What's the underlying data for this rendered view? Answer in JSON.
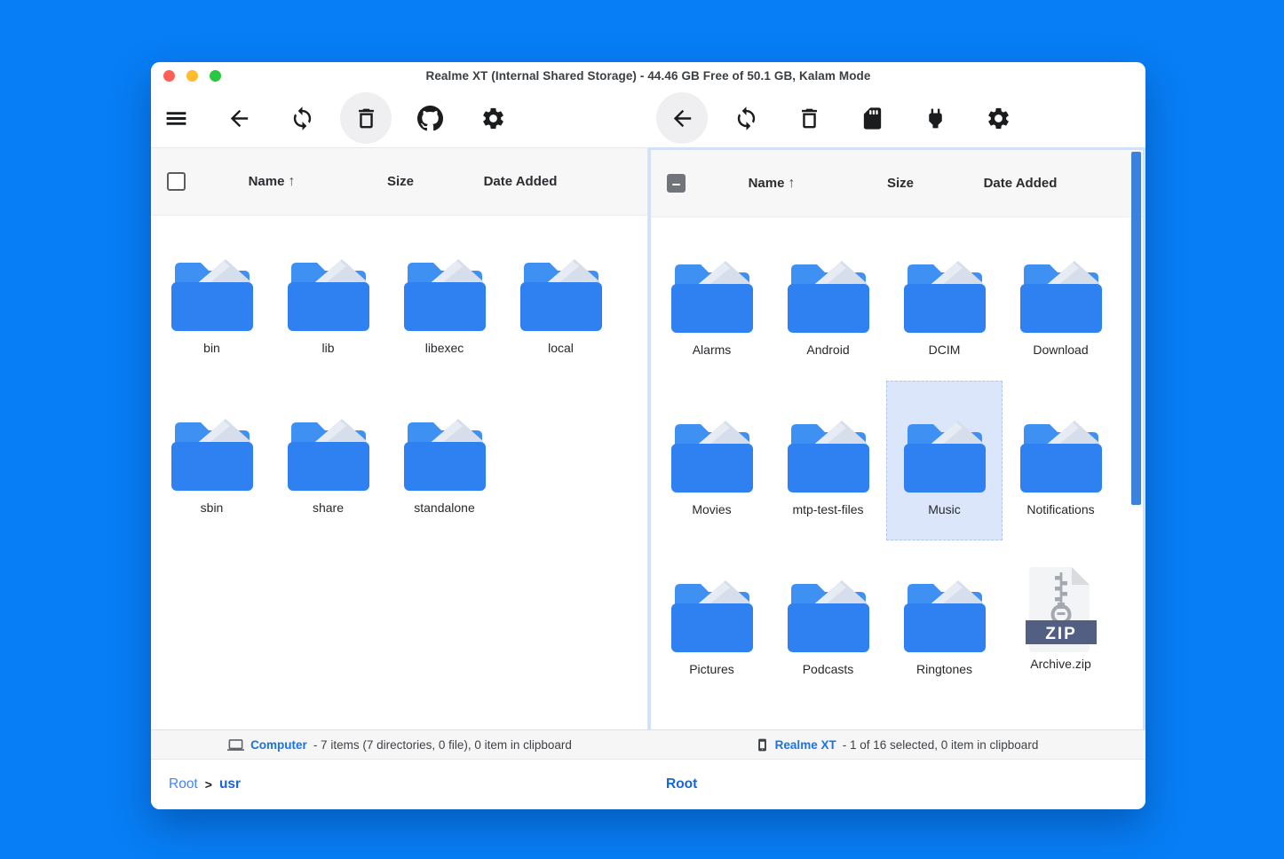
{
  "window": {
    "title": "Realme XT (Internal Shared Storage) - 44.46 GB Free of 50.1 GB, Kalam Mode",
    "controls": [
      "close",
      "minimize",
      "zoom"
    ]
  },
  "columns": {
    "name": "Name",
    "size": "Size",
    "date_added": "Date Added",
    "sort_arrow": "↑"
  },
  "toolbars": {
    "left": [
      "menu",
      "back",
      "refresh",
      "delete",
      "github",
      "settings"
    ],
    "right": [
      "back",
      "refresh",
      "delete",
      "sd-card",
      "usb-plug",
      "settings"
    ]
  },
  "left_pane": {
    "select_state": "unchecked",
    "items": [
      {
        "label": "bin",
        "type": "folder"
      },
      {
        "label": "lib",
        "type": "folder"
      },
      {
        "label": "libexec",
        "type": "folder"
      },
      {
        "label": "local",
        "type": "folder"
      },
      {
        "label": "sbin",
        "type": "folder"
      },
      {
        "label": "share",
        "type": "folder"
      },
      {
        "label": "standalone",
        "type": "folder"
      }
    ],
    "status": {
      "device": "Computer",
      "summary": "- 7 items (7 directories, 0 file), 0 item in clipboard"
    },
    "breadcrumb": {
      "root": "Root",
      "separator": ">",
      "current": "usr"
    }
  },
  "right_pane": {
    "select_state": "indeterminate",
    "items": [
      {
        "label": "Alarms",
        "type": "folder"
      },
      {
        "label": "Android",
        "type": "folder"
      },
      {
        "label": "DCIM",
        "type": "folder"
      },
      {
        "label": "Download",
        "type": "folder"
      },
      {
        "label": "Movies",
        "type": "folder"
      },
      {
        "label": "mtp-test-files",
        "type": "folder"
      },
      {
        "label": "Music",
        "type": "folder",
        "selected": true
      },
      {
        "label": "Notifications",
        "type": "folder"
      },
      {
        "label": "Pictures",
        "type": "folder"
      },
      {
        "label": "Podcasts",
        "type": "folder"
      },
      {
        "label": "Ringtones",
        "type": "folder"
      },
      {
        "label": "Archive.zip",
        "type": "zip"
      }
    ],
    "zip_badge": "ZIP",
    "status": {
      "device": "Realme XT",
      "summary": "- 1 of 16 selected, 0 item in clipboard"
    },
    "breadcrumb": {
      "root": "Root"
    }
  },
  "colors": {
    "desktop_background": "#077ef5",
    "folder_front": "#2f80f0",
    "folder_back": "#3e90f2",
    "folder_paper": "#d6deeb",
    "selection_background": "#dbe6fa",
    "link_blue": "#1a73e8",
    "scrollbar_blue": "#3c82dd",
    "zip_band": "#525f82"
  }
}
